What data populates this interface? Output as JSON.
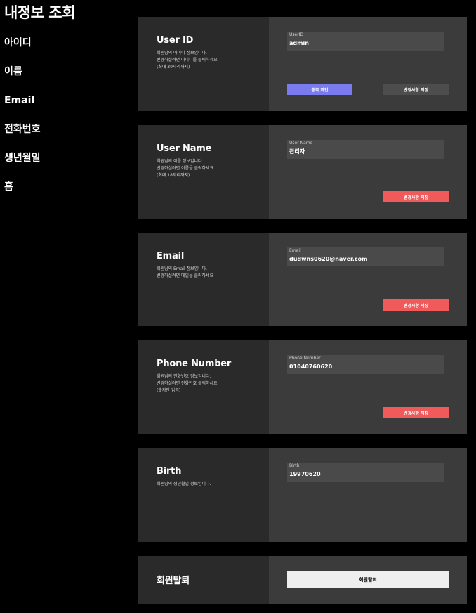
{
  "page_title": "내정보 조회",
  "nav": {
    "items": [
      "아이디",
      "이름",
      "Email",
      "전화번호",
      "생년월일",
      "홈"
    ]
  },
  "buttons": {
    "check_duplicate": "중복 확인",
    "save_changes": "변경사항 저장",
    "withdraw": "회원탈퇴"
  },
  "cards": {
    "userid": {
      "title": "User ID",
      "description": "회원님의 아이디 정보입니다.\n변경하실려면 아이디를 클릭하세요\n(최대 30자리까지)",
      "field_label": "UserID",
      "field_value": "admin"
    },
    "username": {
      "title": "User Name",
      "description": "회원님의 이름 정보입니다.\n변경하실려면 이름을 클릭하세요\n(최대 18자리까지)",
      "field_label": "User Name",
      "field_value": "관리자"
    },
    "email": {
      "title": "Email",
      "description": "회원님의 Email 정보입니다.\n변경하실려면 메일을 클릭하세요",
      "field_label": "Email",
      "field_value": "dudwns0620@naver.com"
    },
    "phone": {
      "title": "Phone Number",
      "description": "회원님의 전화번호 정보입니다.\n변경하실려면 전화번호 클릭하세요\n(숫자만 입력)",
      "field_label": "Phone Number",
      "field_value": "01040760620"
    },
    "birth": {
      "title": "Birth",
      "description": "회원님의 생년월일 정보입니다.",
      "field_label": "Birth",
      "field_value": "19970620"
    },
    "withdraw": {
      "title": "회원탈퇴"
    }
  },
  "colors": {
    "background": "#000000",
    "card_left": "#2a2a2a",
    "card_right": "#3b3b3b",
    "field": "#4a4a4a",
    "accent_blue": "#7b7bf0",
    "accent_red": "#f05a5a",
    "withdraw_button": "#efefef"
  }
}
